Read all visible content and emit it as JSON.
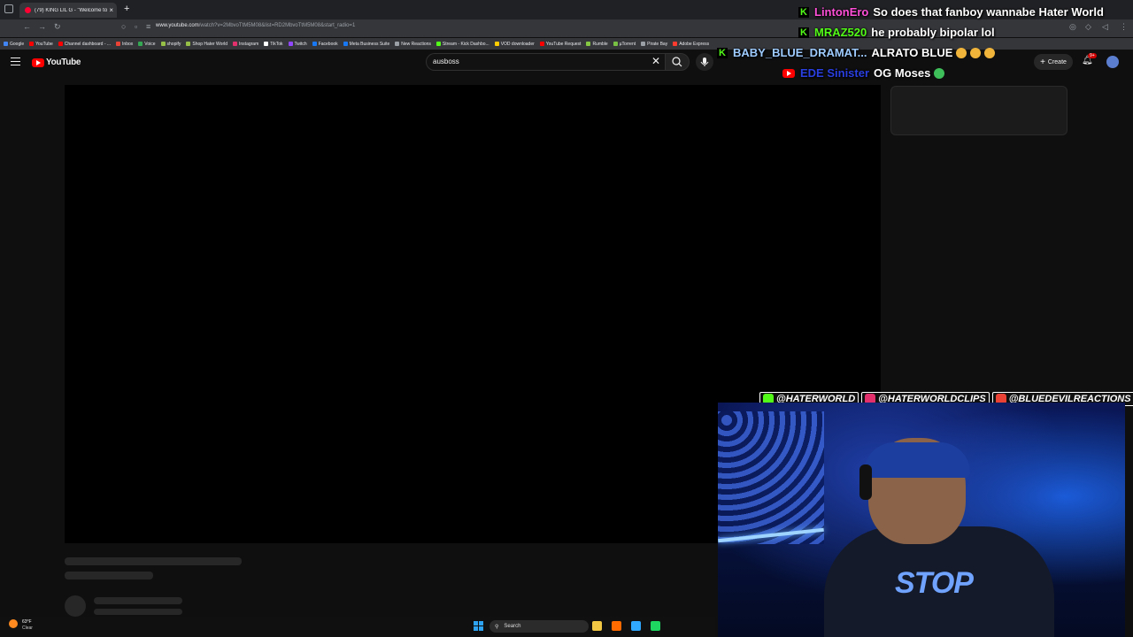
{
  "browser": {
    "tab": {
      "title": "(79) KING LIL G - \"Welcome to",
      "close_glyph": "×"
    },
    "new_tab_glyph": "+",
    "url_host": "www.youtube.com",
    "url_rest": "/watch?v=2MbvoTtM5M08&list=RD2MbvoTtM5M08&start_radio=1",
    "bookmarks": [
      {
        "label": "Google",
        "color": "#4285f4"
      },
      {
        "label": "YouTube",
        "color": "#ff0000"
      },
      {
        "label": "Channel dashboard - ...",
        "color": "#ff0000"
      },
      {
        "label": "Inbox",
        "color": "#ea4335"
      },
      {
        "label": "Voice",
        "color": "#34a853"
      },
      {
        "label": "shopify",
        "color": "#95bf47"
      },
      {
        "label": "Shop Hater World",
        "color": "#95bf47"
      },
      {
        "label": "Instagram",
        "color": "#e1306c"
      },
      {
        "label": "TikTok",
        "color": "#ffffff"
      },
      {
        "label": "Twitch",
        "color": "#9146ff"
      },
      {
        "label": "Facebook",
        "color": "#1877f2"
      },
      {
        "label": "Meta Business Suite",
        "color": "#1877f2"
      },
      {
        "label": "New Reactions",
        "color": "#9aa0a6"
      },
      {
        "label": "Stream - Kick Dashbo...",
        "color": "#53fc18"
      },
      {
        "label": "VOD downloader",
        "color": "#ffcc00"
      },
      {
        "label": "YouTube Request",
        "color": "#ff0000"
      },
      {
        "label": "Rumble",
        "color": "#85c742"
      },
      {
        "label": "µTorrent",
        "color": "#77c043"
      },
      {
        "label": "Pirate Bay",
        "color": "#9aa0a6"
      },
      {
        "label": "Adobe Express",
        "color": "#ff3b30"
      }
    ]
  },
  "youtube": {
    "logo_text": "YouTube",
    "search_value": "ausboss",
    "create_label": "Create",
    "notification_count": "9+"
  },
  "chat": [
    {
      "platform": "kick",
      "user": "LintonEro",
      "user_color": "#ff4fd8",
      "message": "So does that fanboy wannabe Hater World"
    },
    {
      "platform": "kick",
      "user": "MRAZ520",
      "user_color": "#53fc18",
      "message": "he probably bipolar lol"
    },
    {
      "platform": "kick",
      "user": "BABY_BLUE_DRAMAT...",
      "user_color": "#9ecbff",
      "message": "ALRATO BLUE",
      "emotes": [
        "#f0b43a",
        "#f0b43a",
        "#f0b43a"
      ]
    },
    {
      "platform": "youtube",
      "user": "EDE Sinister",
      "user_color": "#2a3fe0",
      "message": "OG Moses",
      "emotes": [
        "#3fbf5a"
      ]
    }
  ],
  "socials": [
    {
      "label": "@HATERWORLD",
      "color": "#53fc18"
    },
    {
      "label": "@HATERWORLDCLIPS",
      "color": "#e1306c"
    },
    {
      "label": "@BLUEDEVILREACTIONS",
      "color": "#ea4335"
    }
  ],
  "webcam": {
    "shirt_text": "STOP"
  },
  "taskbar": {
    "weather_temp": "63°F",
    "weather_desc": "Clear",
    "search_label": "Search",
    "apps": [
      {
        "name": "file-explorer",
        "color": "#f2c744"
      },
      {
        "name": "browser",
        "color": "#ff6a00"
      },
      {
        "name": "photoshop",
        "color": "#31a8ff"
      },
      {
        "name": "app-green",
        "color": "#1ed760"
      }
    ]
  }
}
